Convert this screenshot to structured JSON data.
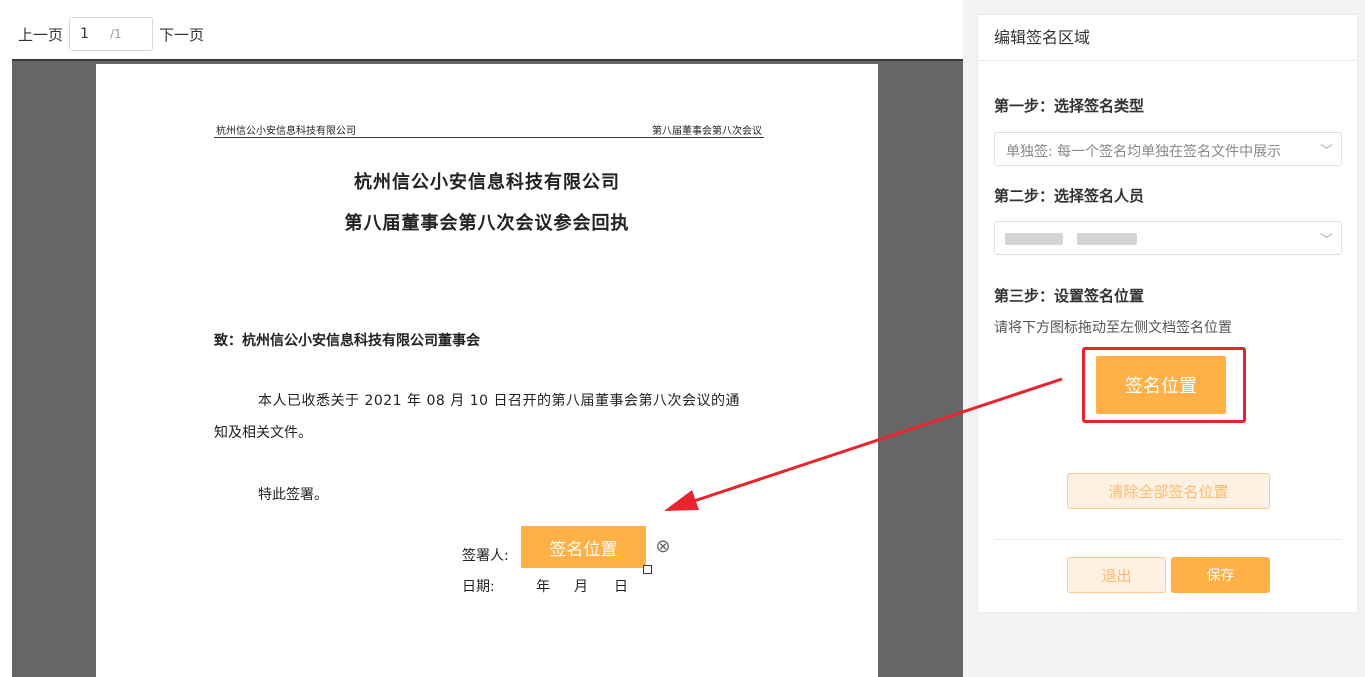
{
  "pager": {
    "prev_label": "上一页",
    "current_page": "1",
    "total_pages": "/1",
    "next_label": "下一页"
  },
  "document": {
    "header_left": "杭州信公小安信息科技有限公司",
    "header_right": "第八届董事会第八次会议",
    "title_line1": "杭州信公小安信息科技有限公司",
    "title_line2": "第八届董事会第八次会议参会回执",
    "addressee": "致：杭州信公小安信息科技有限公司董事会",
    "body_line1": "本人已收悉关于 2021 年 08 月 10 日召开的第八届董事会第八次会议的通",
    "body_line2": "知及相关文件。",
    "body_line3": "特此签署。",
    "signer_label": "签署人:",
    "date_label": "日期:",
    "date_year": "年",
    "date_month": "月",
    "date_day": "日",
    "placed_signature_label": "签名位置",
    "remove_icon": "close-circle-icon"
  },
  "panel": {
    "title": "编辑签名区域",
    "step1_label": "第一步：选择签名类型",
    "step1_value": "单独签: 每一个签名均单独在签名文件中展示",
    "step2_label": "第二步：选择签名人员",
    "step3_label": "第三步：设置签名位置",
    "step3_hint": "请将下方图标拖动至左侧文档签名位置",
    "signature_source_label": "签名位置",
    "clear_all_label": "清除全部签名位置",
    "exit_label": "退出",
    "save_label": "保存"
  },
  "colors": {
    "accent": "#ffb047",
    "accent_light_bg": "#fff1e1",
    "highlight_red": "#e8252f",
    "doc_background": "#666666"
  }
}
